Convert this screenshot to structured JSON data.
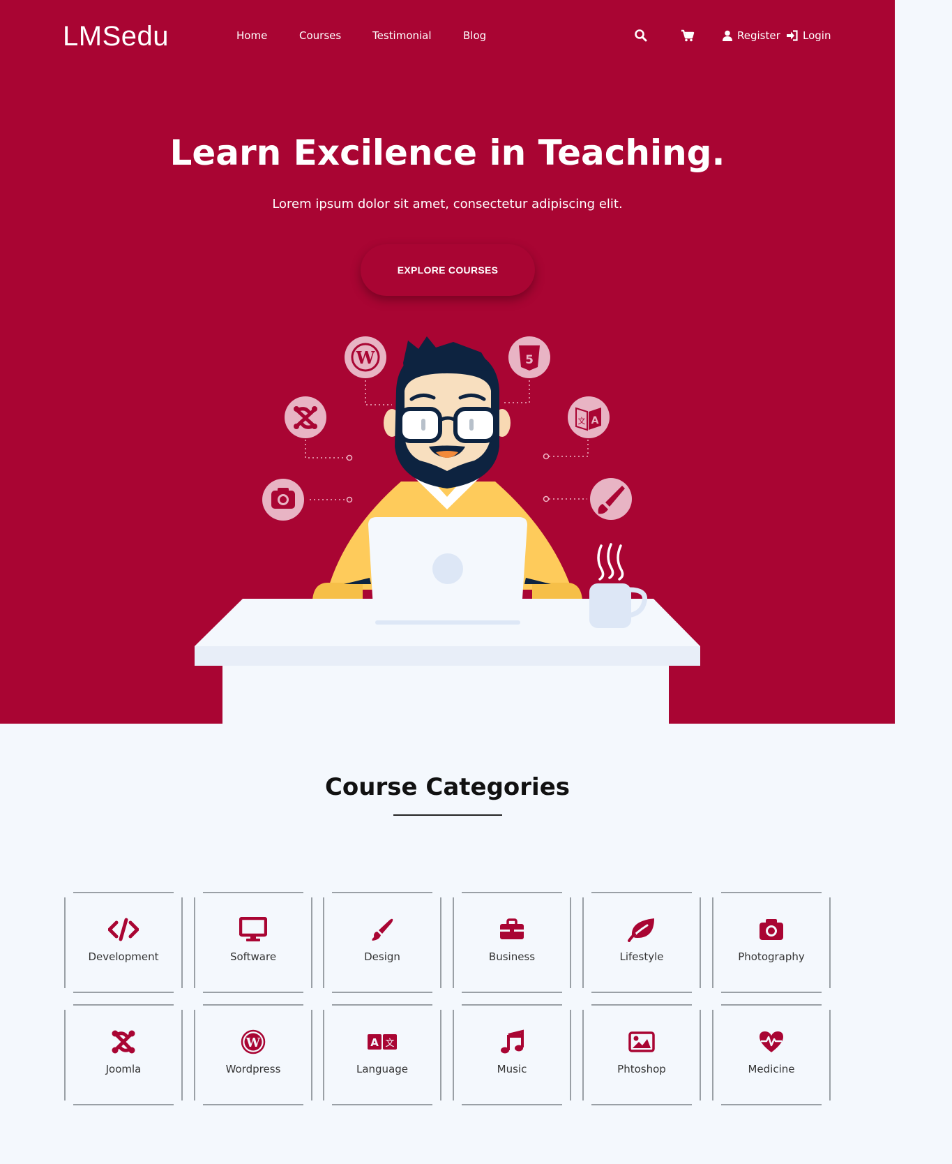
{
  "brand": {
    "logo": "LMSedu",
    "accent": "#a90533"
  },
  "nav": {
    "items": [
      {
        "label": "Home"
      },
      {
        "label": "Courses"
      },
      {
        "label": "Testimonial"
      },
      {
        "label": "Blog"
      }
    ],
    "search_icon": "search-icon",
    "cart_icon": "cart-icon",
    "register": "Register",
    "login": "Login"
  },
  "hero": {
    "title": "Learn Excilence in Teaching.",
    "subtitle": "Lorem ipsum dolor sit amet, consectetur adipiscing elit.",
    "cta": "EXPLORE COURSES"
  },
  "categories": {
    "title": "Course Categories",
    "items": [
      {
        "label": "Development",
        "icon": "code-icon"
      },
      {
        "label": "Software",
        "icon": "monitor-icon"
      },
      {
        "label": "Design",
        "icon": "paintbrush-icon"
      },
      {
        "label": "Business",
        "icon": "briefcase-icon"
      },
      {
        "label": "Lifestyle",
        "icon": "leaf-icon"
      },
      {
        "label": "Photography",
        "icon": "camera-icon"
      },
      {
        "label": "Joomla",
        "icon": "joomla-icon"
      },
      {
        "label": "Wordpress",
        "icon": "wordpress-icon"
      },
      {
        "label": "Language",
        "icon": "language-icon"
      },
      {
        "label": "Music",
        "icon": "music-icon"
      },
      {
        "label": "Phtoshop",
        "icon": "image-icon"
      },
      {
        "label": "Medicine",
        "icon": "heartbeat-icon"
      }
    ]
  }
}
